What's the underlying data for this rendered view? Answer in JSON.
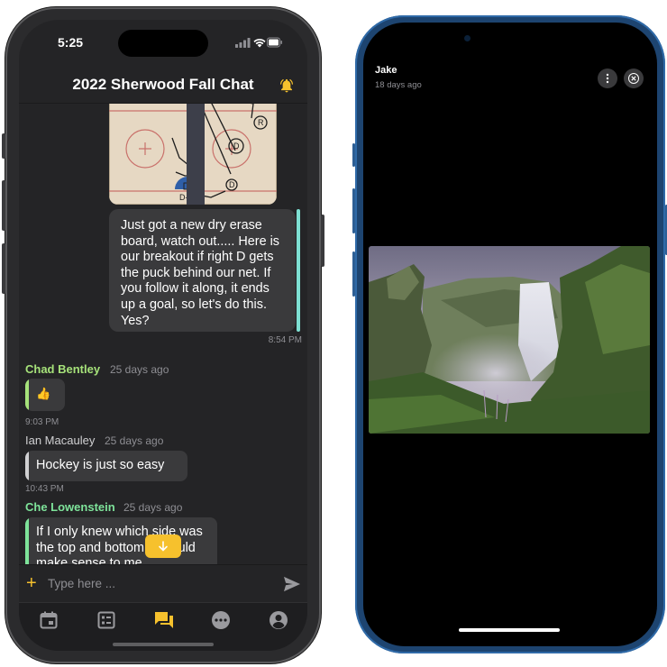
{
  "left_phone": {
    "status": {
      "time": "5:25"
    },
    "chat_title": "2022 Sherwood Fall Chat",
    "messages": {
      "outgoing": {
        "text": "Just got a new dry erase board, watch out..... Here is our breakout if right D gets the puck behind our net. If you follow it along, it ends up a goal, so let's do this. Yes?",
        "time": "8:54 PM"
      },
      "incoming": [
        {
          "sender": "Chad Bentley",
          "ago": "25 days ago",
          "text": "👍",
          "time": "9:03 PM",
          "sender_color": "#a6e27a",
          "bar_color": "#a6e27a"
        },
        {
          "sender": "Ian Macauley",
          "ago": "25 days ago",
          "text": "Hockey is just so easy",
          "time": "10:43 PM",
          "sender_color": "#d0d0d2",
          "bar_color": "#d0d0d2"
        },
        {
          "sender": "Che Lowenstein",
          "ago": "25 days ago",
          "text": "If I only knew which side was the top and bottom, it would make sense to me...",
          "sender_color": "#7ee39a",
          "bar_color": "#7ee39a"
        }
      ]
    },
    "composer": {
      "placeholder": "Type here ..."
    },
    "tabs": [
      "calendar",
      "roster",
      "chat",
      "more",
      "profile"
    ],
    "accent_color": "#f6c12d"
  },
  "right_phone": {
    "viewer": {
      "name": "Jake",
      "ago": "18 days ago"
    },
    "photo": "waterfall"
  }
}
